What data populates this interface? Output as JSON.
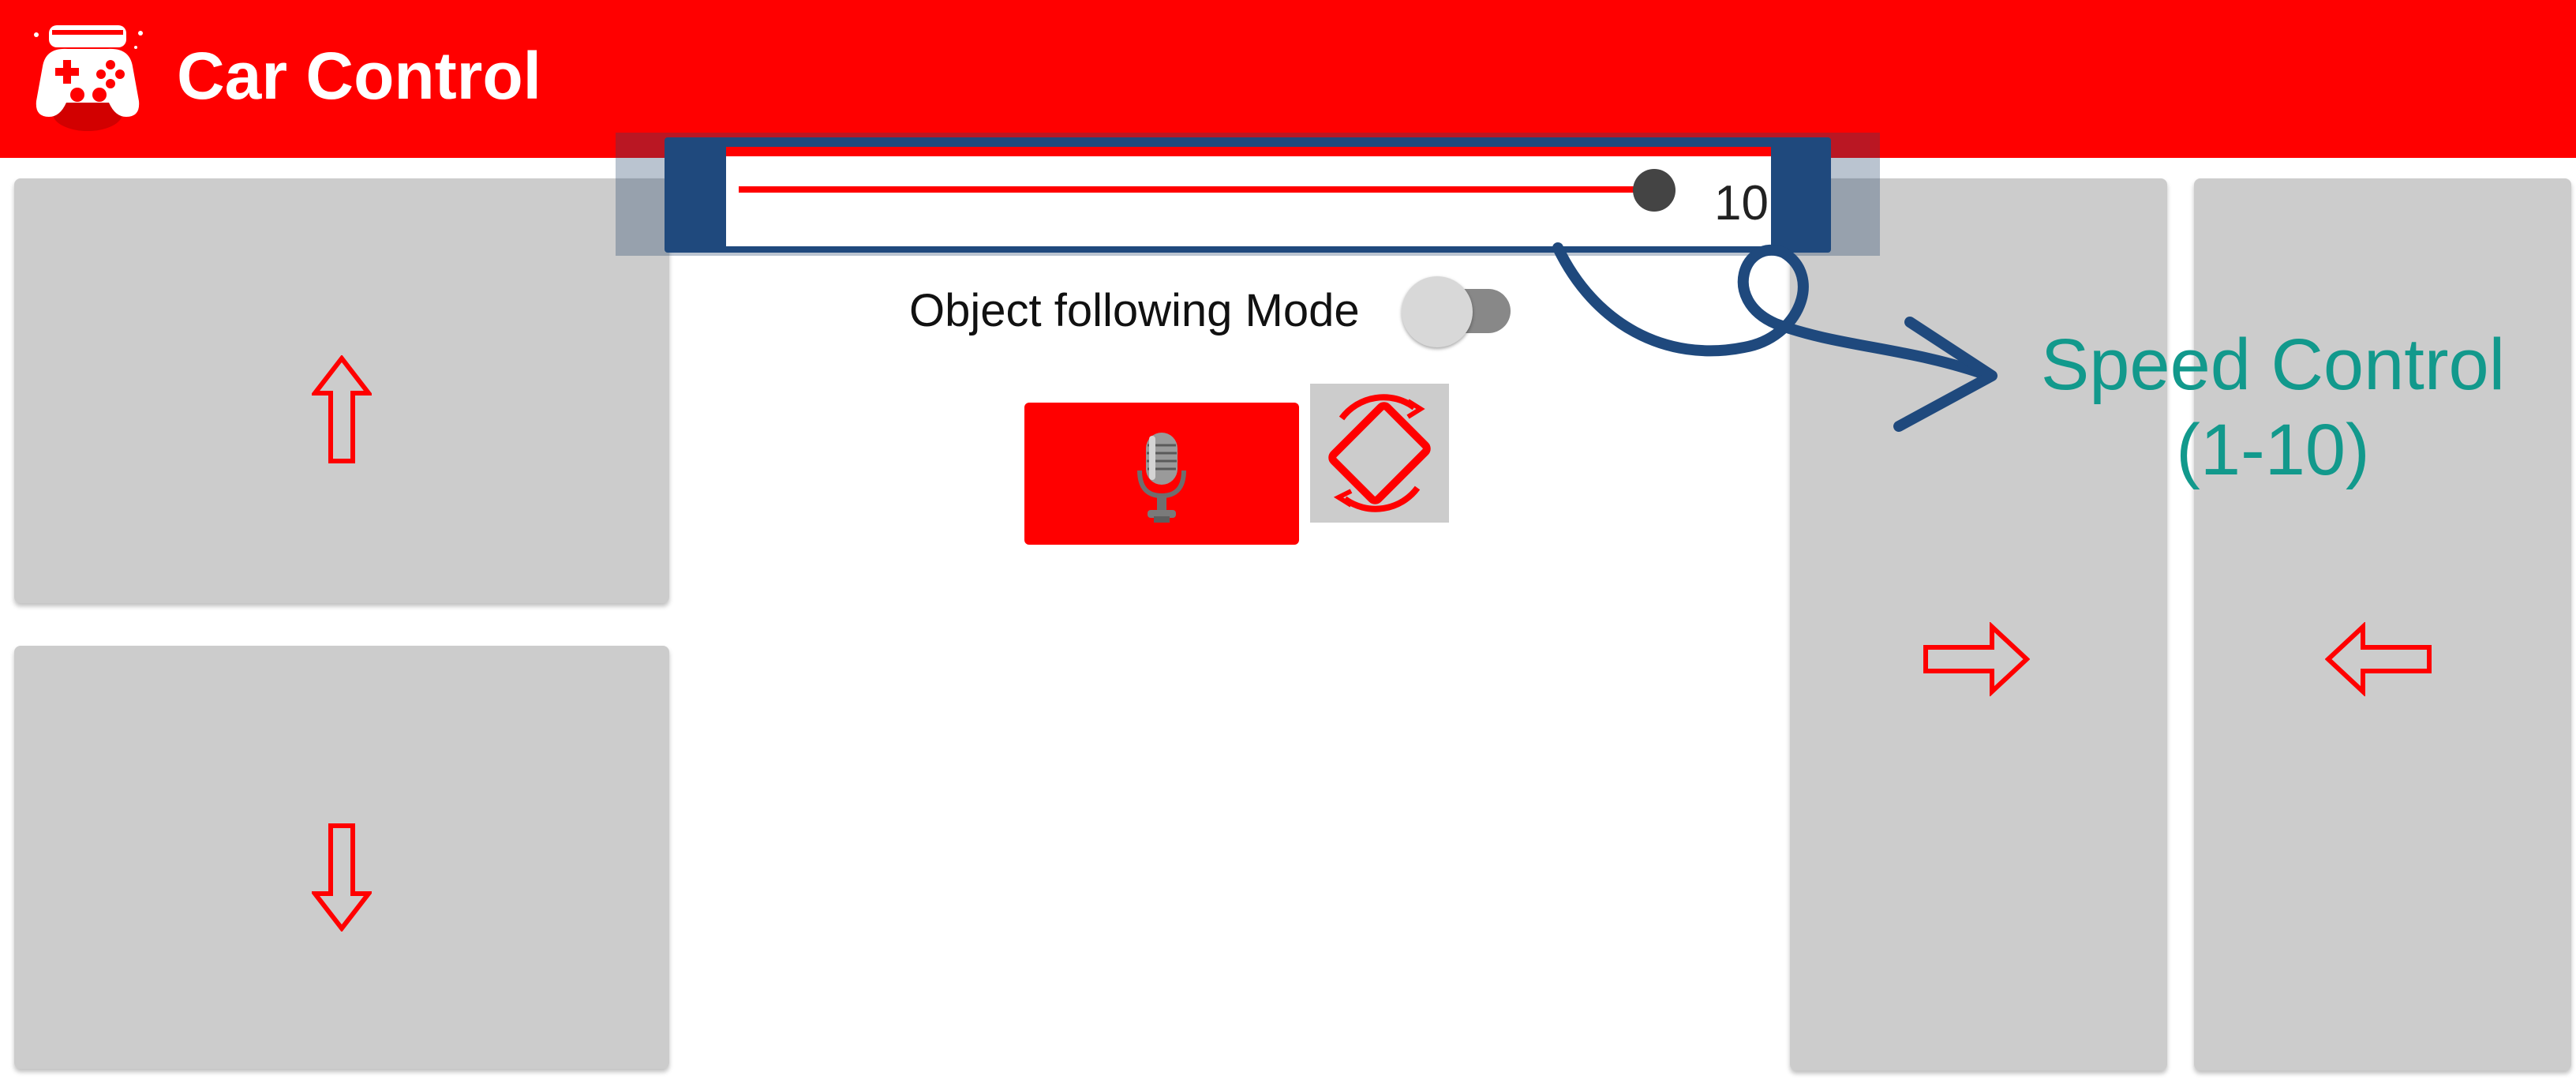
{
  "app": {
    "title": "Car Control",
    "icon": "gamepad-icon",
    "accent_color": "#ff0000"
  },
  "controls": {
    "forward": {
      "icon": "arrow-up-icon"
    },
    "backward": {
      "icon": "arrow-down-icon"
    },
    "right": {
      "icon": "arrow-right-icon"
    },
    "left": {
      "icon": "arrow-left-icon"
    },
    "pad_color": "#cccccc",
    "arrow_color": "#ff0000"
  },
  "speed": {
    "value": "10",
    "min": 1,
    "max": 10,
    "fraction": 1.0
  },
  "object_following": {
    "label": "Object following Mode",
    "enabled": false
  },
  "buttons": {
    "mic": {
      "icon": "microphone-icon"
    },
    "rotate": {
      "icon": "screen-rotation-icon"
    }
  },
  "annotation": {
    "line1": "Speed Control",
    "line2": "(1-10)",
    "color": "#12998c",
    "highlight_color": "#1f497d"
  }
}
